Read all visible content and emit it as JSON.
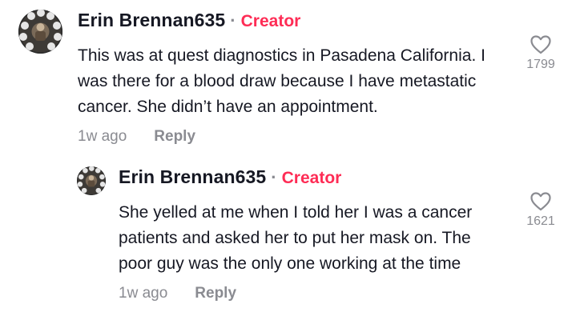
{
  "comments": [
    {
      "username": "Erin Brennan635",
      "separator": "·",
      "badge": "Creator",
      "lines": [
        "This was at quest diagnostics in Pasadena California. I",
        "was there for a blood draw because I have metastatic",
        "cancer. She didn’t have an appointment."
      ],
      "time": "1w ago",
      "reply_label": "Reply",
      "likes": "1799",
      "avatar_icon": "profile-avatar"
    },
    {
      "username": "Erin Brennan635",
      "separator": "·",
      "badge": "Creator",
      "lines": [
        "She yelled at me when I told her I was a cancer",
        "patients and asked her to put her mask on. The",
        "poor guy was the only one working at the time"
      ],
      "time": "1w ago",
      "reply_label": "Reply",
      "likes": "1621",
      "avatar_icon": "profile-avatar"
    }
  ],
  "colors": {
    "creator_badge": "#fe2c55",
    "text_primary": "#161823",
    "text_secondary": "#8a8b91"
  },
  "icons": {
    "like": "heart-outline-icon"
  }
}
